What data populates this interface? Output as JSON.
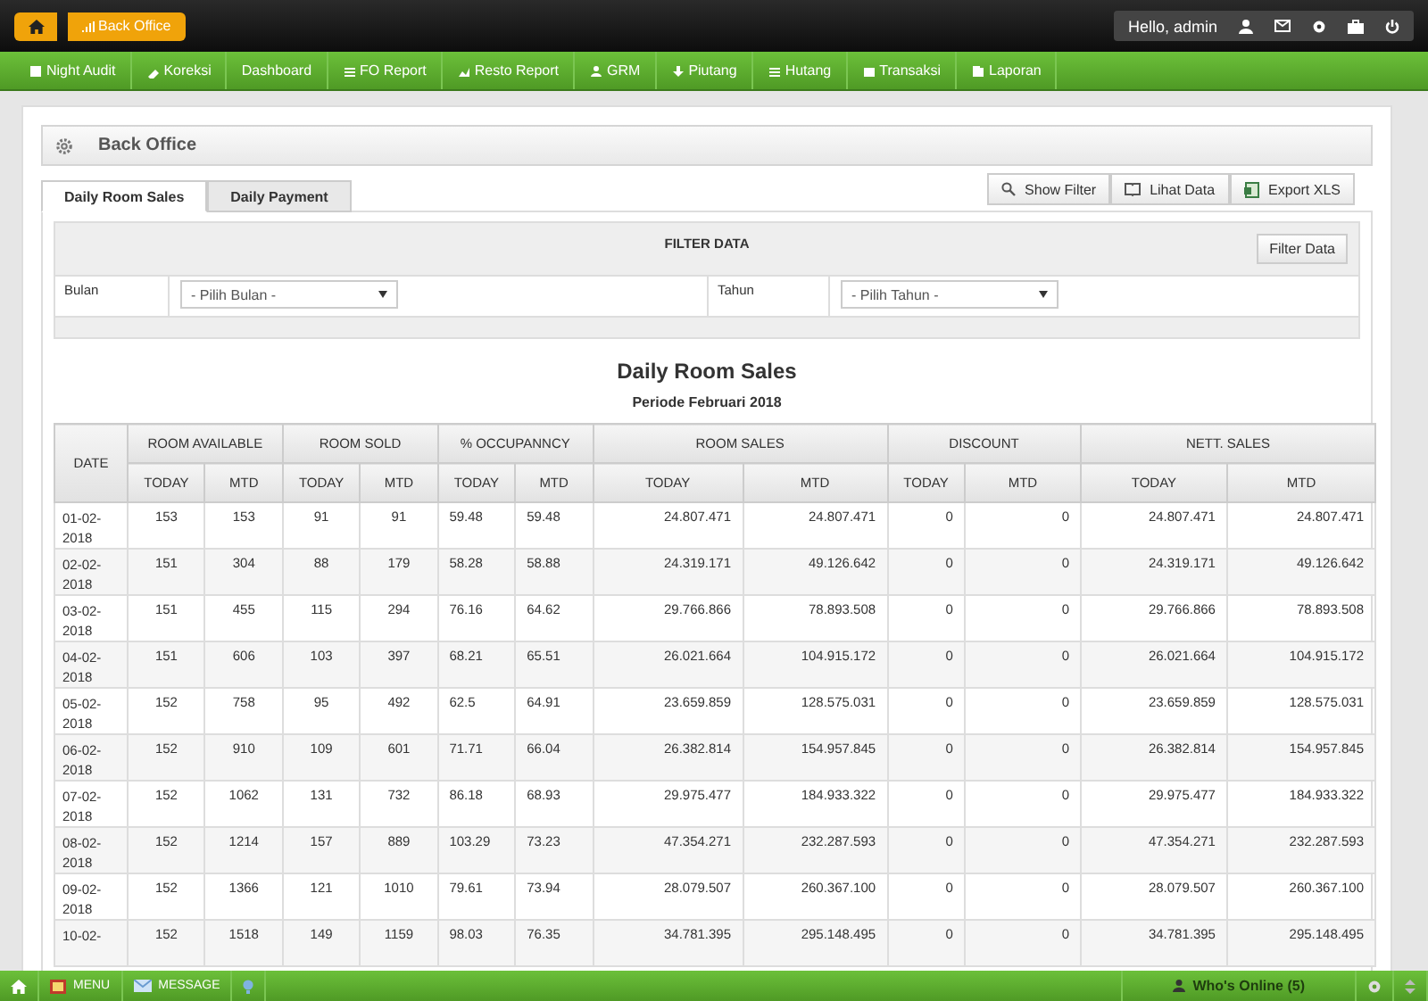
{
  "breadcrumb": {
    "current": "Back Office"
  },
  "user": {
    "greeting": "Hello, admin"
  },
  "nav": [
    "Night Audit",
    "Koreksi",
    "Dashboard",
    "FO Report",
    "Resto Report",
    "GRM",
    "Piutang",
    "Hutang",
    "Transaksi",
    "Laporan"
  ],
  "panel": {
    "title": "Back Office"
  },
  "tabs": [
    {
      "label": "Daily Room Sales",
      "selected": true
    },
    {
      "label": "Daily Payment",
      "selected": false
    }
  ],
  "toolbar": [
    "Show Filter",
    "Lihat Data",
    "Export XLS"
  ],
  "filter": {
    "title": "FILTER DATA",
    "button": "Filter Data",
    "fields": [
      {
        "label": "Bulan",
        "value": "- Pilih Bulan -"
      },
      {
        "label": "Tahun",
        "value": "- Pilih Tahun -"
      }
    ]
  },
  "report": {
    "title": "Daily Room Sales",
    "period": "Periode Februari 2018",
    "date_header": "DATE",
    "groups": [
      {
        "label": "ROOM AVAILABLE",
        "subheaders": [
          "TODAY",
          "MTD"
        ]
      },
      {
        "label": "ROOM SOLD",
        "subheaders": [
          "TODAY",
          "MTD"
        ]
      },
      {
        "label": "% OCCUPANNCY",
        "subheaders": [
          "TODAY",
          "MTD"
        ]
      },
      {
        "label": "ROOM SALES",
        "subheaders": [
          "TODAY",
          "MTD"
        ]
      },
      {
        "label": "DISCOUNT",
        "subheaders": [
          "TODAY",
          "MTD"
        ]
      },
      {
        "label": "NETT. SALES",
        "subheaders": [
          "TODAY",
          "MTD"
        ]
      }
    ],
    "rows": [
      [
        "01-02-2018",
        "153",
        "153",
        "91",
        "91",
        "59.48",
        "59.48",
        "24.807.471",
        "24.807.471",
        "0",
        "0",
        "24.807.471",
        "24.807.471"
      ],
      [
        "02-02-2018",
        "151",
        "304",
        "88",
        "179",
        "58.28",
        "58.88",
        "24.319.171",
        "49.126.642",
        "0",
        "0",
        "24.319.171",
        "49.126.642"
      ],
      [
        "03-02-2018",
        "151",
        "455",
        "115",
        "294",
        "76.16",
        "64.62",
        "29.766.866",
        "78.893.508",
        "0",
        "0",
        "29.766.866",
        "78.893.508"
      ],
      [
        "04-02-2018",
        "151",
        "606",
        "103",
        "397",
        "68.21",
        "65.51",
        "26.021.664",
        "104.915.172",
        "0",
        "0",
        "26.021.664",
        "104.915.172"
      ],
      [
        "05-02-2018",
        "152",
        "758",
        "95",
        "492",
        "62.5",
        "64.91",
        "23.659.859",
        "128.575.031",
        "0",
        "0",
        "23.659.859",
        "128.575.031"
      ],
      [
        "06-02-2018",
        "152",
        "910",
        "109",
        "601",
        "71.71",
        "66.04",
        "26.382.814",
        "154.957.845",
        "0",
        "0",
        "26.382.814",
        "154.957.845"
      ],
      [
        "07-02-2018",
        "152",
        "1062",
        "131",
        "732",
        "86.18",
        "68.93",
        "29.975.477",
        "184.933.322",
        "0",
        "0",
        "29.975.477",
        "184.933.322"
      ],
      [
        "08-02-2018",
        "152",
        "1214",
        "157",
        "889",
        "103.29",
        "73.23",
        "47.354.271",
        "232.287.593",
        "0",
        "0",
        "47.354.271",
        "232.287.593"
      ],
      [
        "09-02-2018",
        "152",
        "1366",
        "121",
        "1010",
        "79.61",
        "73.94",
        "28.079.507",
        "260.367.100",
        "0",
        "0",
        "28.079.507",
        "260.367.100"
      ],
      [
        "10-02-",
        "152",
        "1518",
        "149",
        "1159",
        "98.03",
        "76.35",
        "34.781.395",
        "295.148.495",
        "0",
        "0",
        "34.781.395",
        "295.148.495"
      ]
    ]
  },
  "footer": {
    "items": [
      "MENU",
      "MESSAGE"
    ],
    "online": "Who's Online (5)"
  }
}
